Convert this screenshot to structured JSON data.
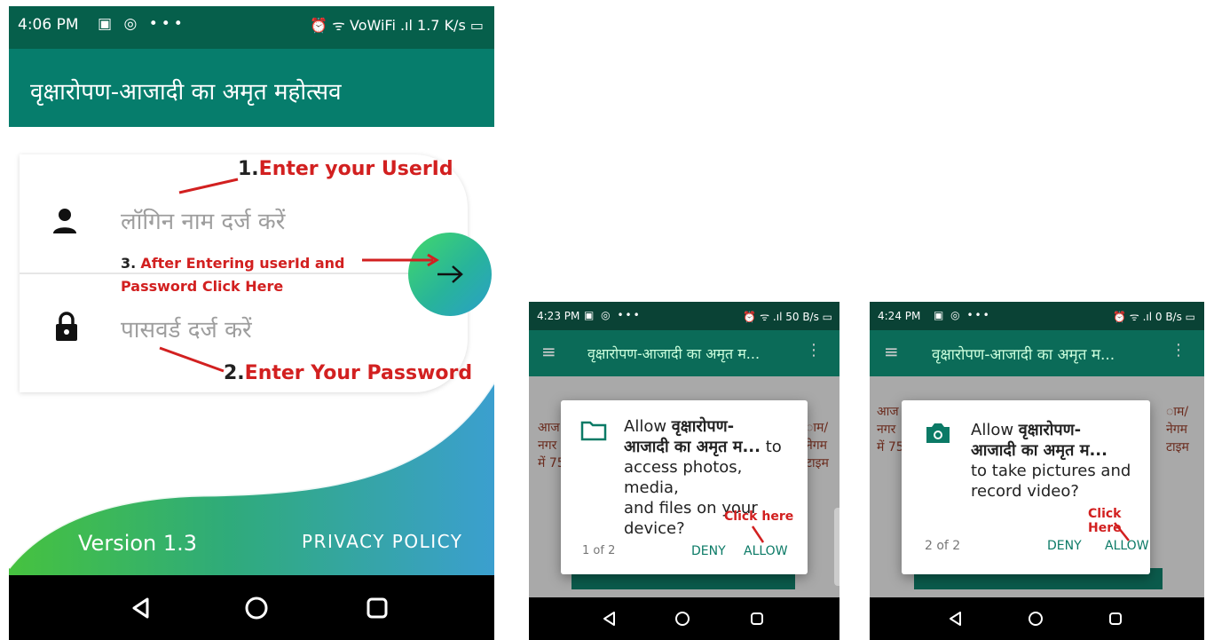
{
  "screen1": {
    "status": {
      "time": "4:06 PM",
      "right": "⏰ ᯤ VoWiFi .ıl 1.7 K/s ▭"
    },
    "app_title": "वृक्षारोपण-आजादी का अमृत महोत्सव",
    "username_placeholder": "लॉगिन नाम दर्ज करें",
    "password_placeholder": "पासवर्ड दर्ज करें",
    "annotations": {
      "step1_num": "1.",
      "step1": "Enter your UserId",
      "step2_num": "2.",
      "step2": "Enter Your Password",
      "step3_num": "3.",
      "step3_line1": "After Entering userId and",
      "step3_line2": "Password Click Here"
    },
    "version": "Version 1.3",
    "privacy": "PRIVACY POLICY"
  },
  "screen2": {
    "status": {
      "time": "4:23 PM",
      "right": "⏰ ᯤ .ıl 50 B/s ▭"
    },
    "app_title": "वृक्षारोपण-आजादी का अमृत म...",
    "dialog": {
      "prefix": "Allow ",
      "app_name_1": "वृक्षारोपण-",
      "app_name_2": "आजादी का अमृत म...",
      "suffix_1": " to",
      "line_3": "access photos, media,",
      "line_4": "and files on your",
      "line_5": "device?",
      "counter": "1 of 2",
      "deny": "DENY",
      "allow": "ALLOW"
    },
    "click_label": "Click here",
    "bg_lines": [
      "आज",
      "नगर",
      "में 75"
    ],
    "bg_right_lines": [
      "ाम/",
      "नेगम",
      "टाइम"
    ]
  },
  "screen3": {
    "status": {
      "time": "4:24 PM",
      "right": "⏰ ᯤ .ıl 0 B/s ▭"
    },
    "app_title": "वृक्षारोपण-आजादी का अमृत म...",
    "dialog": {
      "prefix": "Allow ",
      "app_name_1": "वृक्षारोपण-",
      "app_name_2": "आजादी का अमृत म...",
      "line_3": "to take pictures and",
      "line_4": "record video?",
      "counter": "2 of 2",
      "deny": "DENY",
      "allow": "ALLOW"
    },
    "click_label": "Click Here",
    "bg_lines": [
      "आज",
      "नगर",
      "में 75"
    ],
    "bg_right_lines": [
      "ाम/",
      "नेगम",
      "टाइम"
    ]
  }
}
